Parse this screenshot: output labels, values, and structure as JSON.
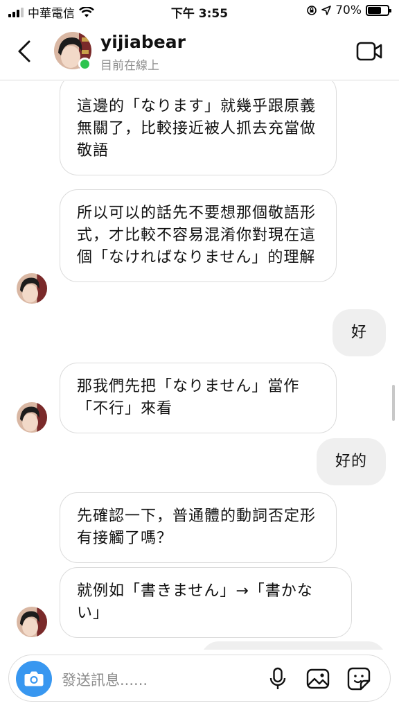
{
  "status": {
    "carrier": "中華電信",
    "time": "下午 3:55",
    "battery": "70%",
    "battery_level": 0.7
  },
  "header": {
    "username": "yijiabear",
    "presence": "目前在線上",
    "online_color": "#2ec44f"
  },
  "messages": [
    {
      "side": "in",
      "text": "這邊的「なります」就幾乎跟原義無關了，比較接近被人抓去充當做敬語"
    },
    {
      "side": "in",
      "text": "所以可以的話先不要想那個敬語形式，才比較不容易混淆你對現在這個「なければなりません」的理解"
    },
    {
      "side": "out",
      "text": "好"
    },
    {
      "side": "in",
      "text": "那我們先把「なりません」當作「不行」來看"
    },
    {
      "side": "out",
      "text": "好的"
    },
    {
      "side": "in",
      "text": "先確認一下，普通體的動詞否定形有接觸了嗎？"
    },
    {
      "side": "in",
      "text": "就例如「書きません」→「書かない」"
    }
  ],
  "composer": {
    "placeholder": "發送訊息......",
    "icons": [
      "camera-icon",
      "microphone-icon",
      "image-icon",
      "sticker-icon"
    ],
    "camera_color": "#3897f0"
  }
}
